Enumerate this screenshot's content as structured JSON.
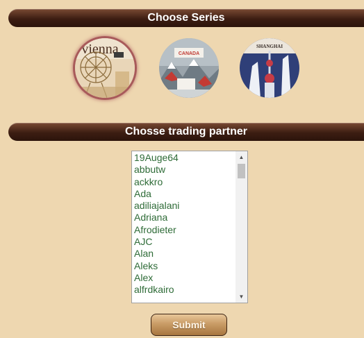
{
  "section_series": {
    "title": "Choose Series"
  },
  "series": [
    {
      "name": "vienna",
      "icon": "vienna-ferris-wheel-thumbnail",
      "selected": true,
      "caption": "vienna"
    },
    {
      "name": "canada",
      "icon": "canada-mountains-thumbnail",
      "selected": false,
      "caption": "CANADA"
    },
    {
      "name": "shanghai",
      "icon": "shanghai-tower-thumbnail",
      "selected": false,
      "caption": "SHANGHAI"
    }
  ],
  "section_partner": {
    "title": "Chosse trading partner"
  },
  "partners": [
    "19Auge64",
    "abbutw",
    "ackkro",
    "Ada",
    "adiliajalani",
    "Adriana",
    "Afrodieter",
    "AJC",
    "Alan",
    "Aleks",
    "Alex",
    "alfrdkairo"
  ],
  "submit_label": "Submit",
  "colors": {
    "background": "#eed7b0",
    "bar_dark": "#2c140b",
    "list_text": "#2e6b37",
    "selected_ring": "#a85a5a"
  }
}
